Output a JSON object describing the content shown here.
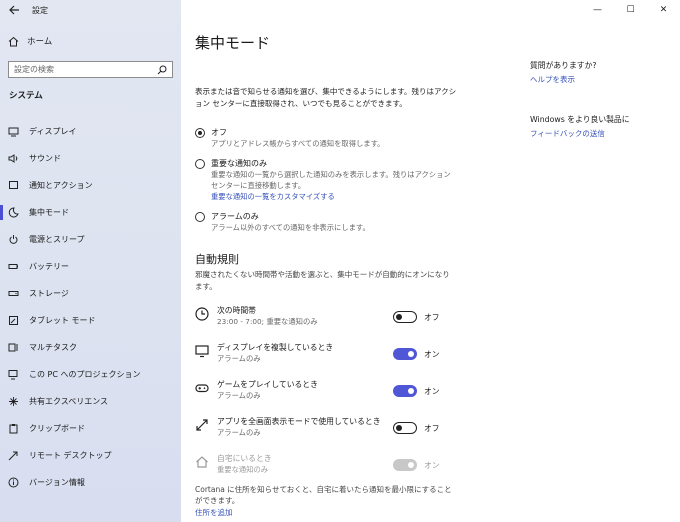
{
  "window": {
    "title": "設定",
    "controls": [
      "—",
      "☐",
      "✕"
    ]
  },
  "sidebar": {
    "home": "ホーム",
    "search_placeholder": "設定の検索",
    "section": "システム",
    "items": [
      {
        "label": "ディスプレイ",
        "icon": "display-icon"
      },
      {
        "label": "サウンド",
        "icon": "sound-icon"
      },
      {
        "label": "通知とアクション",
        "icon": "notification-icon"
      },
      {
        "label": "集中モード",
        "icon": "moon-icon",
        "active": true
      },
      {
        "label": "電源とスリープ",
        "icon": "power-icon"
      },
      {
        "label": "バッテリー",
        "icon": "battery-icon"
      },
      {
        "label": "ストレージ",
        "icon": "storage-icon"
      },
      {
        "label": "タブレット モード",
        "icon": "tablet-icon"
      },
      {
        "label": "マルチタスク",
        "icon": "multitask-icon"
      },
      {
        "label": "この PC へのプロジェクション",
        "icon": "projection-icon"
      },
      {
        "label": "共有エクスペリエンス",
        "icon": "share-icon"
      },
      {
        "label": "クリップボード",
        "icon": "clipboard-icon"
      },
      {
        "label": "リモート デスクトップ",
        "icon": "remote-icon"
      },
      {
        "label": "バージョン情報",
        "icon": "info-icon"
      }
    ]
  },
  "main": {
    "title": "集中モード",
    "description": "表示または音で知らせる通知を選び、集中できるようにします。残りはアクション センターに直接取得され、いつでも見ることができます。",
    "options": [
      {
        "title": "オフ",
        "sub": "アプリとアドレス帳からすべての通知を取得します。",
        "checked": true
      },
      {
        "title": "重要な通知のみ",
        "sub": "重要な通知の一覧から選択した通知のみを表示します。残りはアクション センターに直接移動します。",
        "link": "重要な通知の一覧をカスタマイズする",
        "checked": false
      },
      {
        "title": "アラームのみ",
        "sub": "アラーム以外のすべての通知を非表示にします。",
        "checked": false
      }
    ],
    "auto_title": "自動規則",
    "auto_desc": "邪魔されたくない時間帯や活動を選ぶと、集中モードが自動的にオンになります。",
    "rules": [
      {
        "title": "次の時間帯",
        "sub": "23:00 - 7:00; 重要な通知のみ",
        "state": "オフ",
        "on": false,
        "icon": "clock-icon"
      },
      {
        "title": "ディスプレイを複製しているとき",
        "sub": "アラームのみ",
        "state": "オン",
        "on": true,
        "icon": "monitor-icon"
      },
      {
        "title": "ゲームをプレイしているとき",
        "sub": "アラームのみ",
        "state": "オン",
        "on": true,
        "icon": "gamepad-icon"
      },
      {
        "title": "アプリを全画面表示モードで使用しているとき",
        "sub": "アラームのみ",
        "state": "オフ",
        "on": false,
        "icon": "fullscreen-icon"
      },
      {
        "title": "自宅にいるとき",
        "sub": "重要な通知のみ",
        "state": "オン",
        "on": true,
        "disabled": true,
        "icon": "home-icon"
      }
    ],
    "cortana_text": "Cortana に住所を知らせておくと、自宅に着いたら通知を最小限にすることができます。",
    "cortana_link": "住所を追加"
  },
  "right": {
    "help_question": "質問がありますか?",
    "help_link": "ヘルプを表示",
    "improve_question": "Windows をより良い製品に",
    "improve_link": "フィードバックの送信"
  }
}
